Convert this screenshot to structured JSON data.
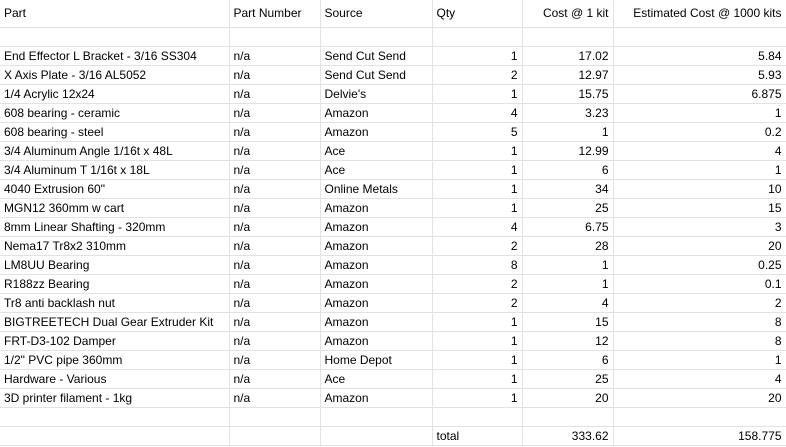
{
  "headers": [
    "Part",
    "Part Number",
    "Source",
    "Qty",
    "Cost @ 1 kit",
    "Estimated Cost @ 1000 kits"
  ],
  "rows": [
    [
      "End Effector L Bracket - 3/16 SS304",
      "n/a",
      "Send Cut Send",
      "1",
      "17.02",
      "5.84"
    ],
    [
      "X Axis Plate - 3/16 AL5052",
      "n/a",
      "Send Cut Send",
      "2",
      "12.97",
      "5.93"
    ],
    [
      "1/4 Acrylic 12x24",
      "n/a",
      "Delvie's",
      "1",
      "15.75",
      "6.875"
    ],
    [
      "608 bearing - ceramic",
      "n/a",
      "Amazon",
      "4",
      "3.23",
      "1"
    ],
    [
      "608 bearing - steel",
      "n/a",
      "Amazon",
      "5",
      "1",
      "0.2"
    ],
    [
      "3/4 Aluminum Angle 1/16t x 48L",
      "n/a",
      "Ace",
      "1",
      "12.99",
      "4"
    ],
    [
      "3/4 Aluminum T 1/16t x 18L",
      "n/a",
      "Ace",
      "1",
      "6",
      "1"
    ],
    [
      "4040 Extrusion 60\"",
      "n/a",
      "Online Metals",
      "1",
      "34",
      "10"
    ],
    [
      "MGN12 360mm w cart",
      "n/a",
      "Amazon",
      "1",
      "25",
      "15"
    ],
    [
      "8mm Linear Shafting - 320mm",
      "n/a",
      "Amazon",
      "4",
      "6.75",
      "3"
    ],
    [
      "Nema17 Tr8x2 310mm",
      "n/a",
      "Amazon",
      "2",
      "28",
      "20"
    ],
    [
      "LM8UU Bearing",
      "n/a",
      "Amazon",
      "8",
      "1",
      "0.25"
    ],
    [
      "R188zz Bearing",
      "n/a",
      "Amazon",
      "2",
      "1",
      "0.1"
    ],
    [
      "Tr8 anti backlash nut",
      "n/a",
      "Amazon",
      "2",
      "4",
      "2"
    ],
    [
      "BIGTREETECH Dual Gear Extruder Kit",
      "n/a",
      "Amazon",
      "1",
      "15",
      "8"
    ],
    [
      "FRT-D3-102 Damper",
      "n/a",
      "Amazon",
      "1",
      "12",
      "8"
    ],
    [
      "1/2\" PVC pipe 360mm",
      "n/a",
      "Home Depot",
      "1",
      "6",
      "1"
    ],
    [
      "Hardware - Various",
      "n/a",
      "Ace",
      "1",
      "25",
      "4"
    ],
    [
      "3D printer filament - 1kg",
      "n/a",
      "Amazon",
      "1",
      "20",
      "20"
    ]
  ],
  "totals": {
    "label": "total",
    "cost_1": "333.62",
    "cost_1000": "158.775"
  }
}
